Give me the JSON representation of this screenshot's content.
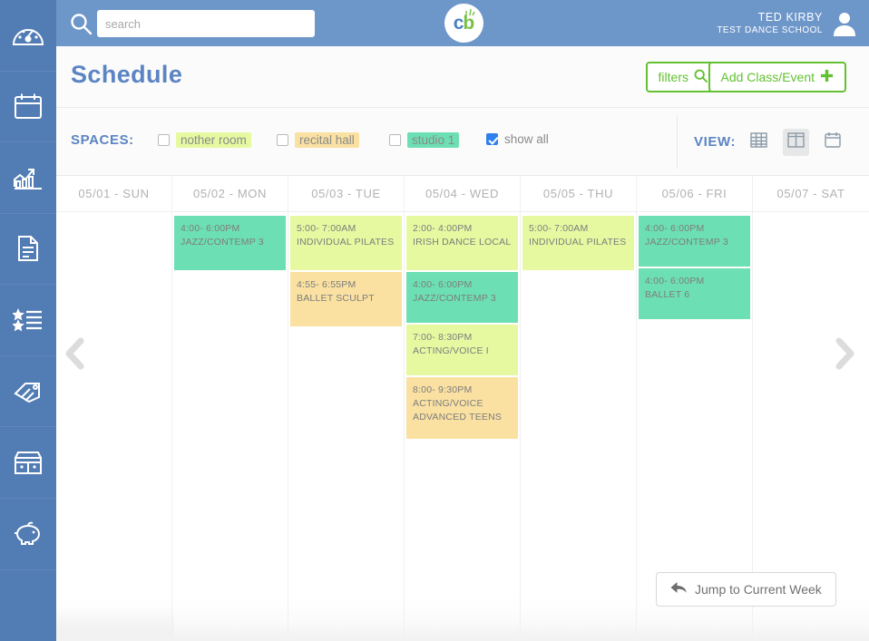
{
  "topbar": {
    "search_placeholder": "search",
    "search_value": "",
    "logo_c": "c",
    "logo_b": "b",
    "user_name": "TED KIRBY",
    "user_org": "TEST DANCE SCHOOL"
  },
  "sidebar": {
    "items": [
      {
        "icon": "dashboard-gauge-icon",
        "label": "Dashboard"
      },
      {
        "icon": "calendar-icon",
        "label": "Schedule"
      },
      {
        "icon": "chart-growth-icon",
        "label": "Reports"
      },
      {
        "icon": "document-icon",
        "label": "Documents"
      },
      {
        "icon": "star-list-icon",
        "label": "Classes"
      },
      {
        "icon": "tag-icon",
        "label": "Pricing"
      },
      {
        "icon": "storefront-icon",
        "label": "Store"
      },
      {
        "icon": "piggy-bank-icon",
        "label": "Finances"
      }
    ]
  },
  "header": {
    "title": "Schedule",
    "filters_label": "filters",
    "add_label": "Add Class/Event"
  },
  "spaces": {
    "label": "SPACES:",
    "items": [
      {
        "name": "nother room",
        "checked": false,
        "color": "#e6f9a1"
      },
      {
        "name": "recital hall",
        "checked": false,
        "color": "#fae1a2"
      },
      {
        "name": "studio 1",
        "checked": false,
        "color": "#6ddfb4"
      }
    ],
    "show_all_label": "show all",
    "show_all_checked": true
  },
  "view": {
    "label": "VIEW:",
    "options": [
      {
        "name": "grid-view",
        "active": false
      },
      {
        "name": "column-view",
        "active": true
      },
      {
        "name": "month-view",
        "active": false
      }
    ]
  },
  "calendar": {
    "days": [
      {
        "header": "05/01 - SUN",
        "events": []
      },
      {
        "header": "05/02 - MON",
        "events": [
          {
            "time": "4:00- 6:00PM",
            "title": "JAZZ/CONTEMP 3",
            "color": "teal",
            "height": "ev-h60"
          }
        ]
      },
      {
        "header": "05/03 - TUE",
        "events": [
          {
            "time": "5:00- 7:00AM",
            "title": "INDIVIDUAL PILATES",
            "color": "lime",
            "height": "ev-h60"
          },
          {
            "time": "4:55- 6:55PM",
            "title": "BALLET SCULPT",
            "color": "peach",
            "height": "ev-h60"
          }
        ]
      },
      {
        "header": "05/04 - WED",
        "events": [
          {
            "time": "2:00- 4:00PM",
            "title": "IRISH DANCE LOCAL",
            "color": "lime",
            "height": "ev-h60"
          },
          {
            "time": "4:00- 6:00PM",
            "title": "JAZZ/CONTEMP 3",
            "color": "teal",
            "height": "ev-h56"
          },
          {
            "time": "7:00- 8:30PM",
            "title": "ACTING/VOICE I",
            "color": "lime",
            "height": "ev-h56"
          },
          {
            "time": "8:00- 9:30PM",
            "title": "ACTING/VOICE ADVANCED TEENS",
            "color": "peach",
            "height": "ev-h68"
          }
        ]
      },
      {
        "header": "05/05 - THU",
        "events": [
          {
            "time": "5:00- 7:00AM",
            "title": "INDIVIDUAL PILATES",
            "color": "lime",
            "height": "ev-h60"
          }
        ]
      },
      {
        "header": "05/06 - FRI",
        "events": [
          {
            "time": "4:00- 6:00PM",
            "title": "JAZZ/CONTEMP 3",
            "color": "teal",
            "height": "ev-h56"
          },
          {
            "time": "4:00- 6:00PM",
            "title": "BALLET 6",
            "color": "teal",
            "height": "ev-h56"
          }
        ]
      },
      {
        "header": "05/07 - SAT",
        "events": []
      }
    ],
    "jump_label": "Jump to Current Week",
    "prev_label": "Previous week",
    "next_label": "Next week"
  }
}
